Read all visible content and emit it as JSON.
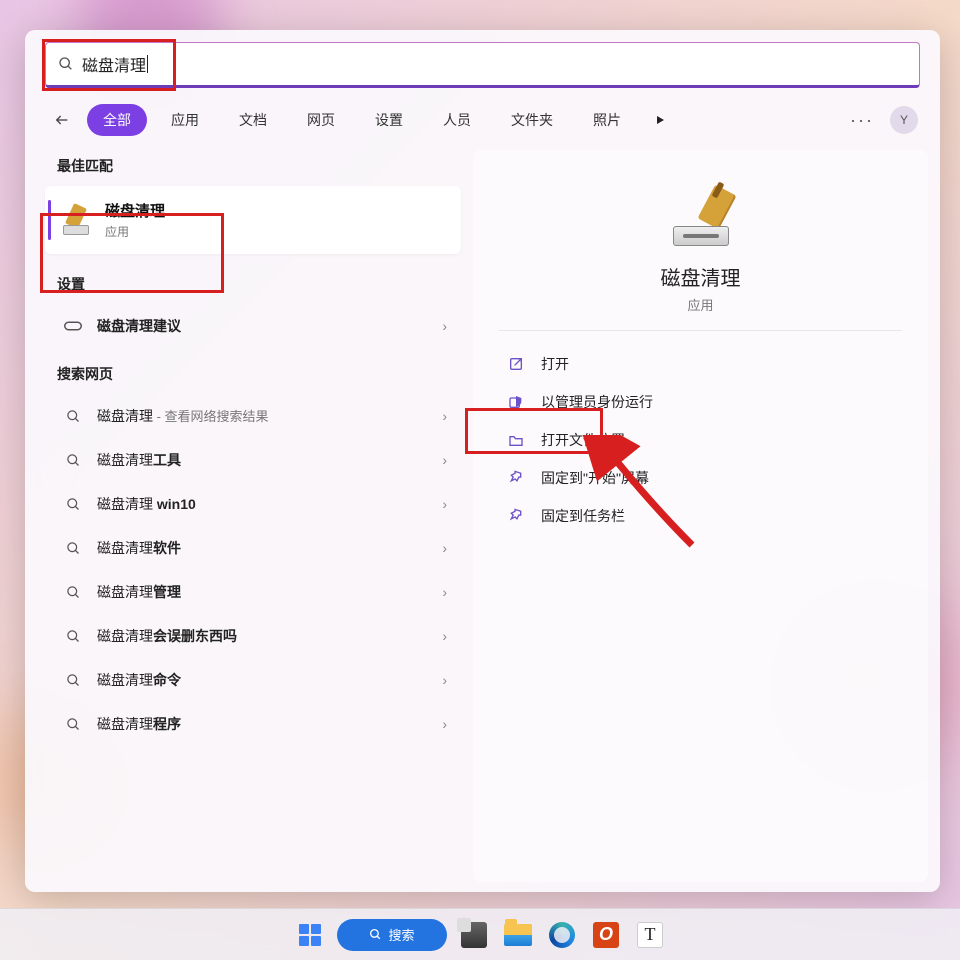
{
  "search": {
    "query": "磁盘清理"
  },
  "tabs": {
    "items": [
      "全部",
      "应用",
      "文档",
      "网页",
      "设置",
      "人员",
      "文件夹",
      "照片"
    ],
    "activeIndex": 0
  },
  "user": {
    "initial": "Y"
  },
  "sections": {
    "bestMatch": {
      "title": "最佳匹配"
    },
    "settings": {
      "title": "设置"
    },
    "web": {
      "title": "搜索网页"
    }
  },
  "bestMatch": {
    "title": "磁盘清理",
    "subtitle": "应用"
  },
  "settingsItems": [
    {
      "prefix": "",
      "bold": "磁盘清理建议",
      "suffix": ""
    }
  ],
  "webResults": [
    {
      "prefix": "磁盘清理",
      "bold": "",
      "suffix": " - 查看网络搜索结果"
    },
    {
      "prefix": "磁盘清理",
      "bold": "工具",
      "suffix": ""
    },
    {
      "prefix": "磁盘清理 ",
      "bold": "win10",
      "suffix": ""
    },
    {
      "prefix": "磁盘清理",
      "bold": "软件",
      "suffix": ""
    },
    {
      "prefix": "磁盘清理",
      "bold": "管理",
      "suffix": ""
    },
    {
      "prefix": "磁盘清理",
      "bold": "会误删东西吗",
      "suffix": ""
    },
    {
      "prefix": "磁盘清理",
      "bold": "命令",
      "suffix": ""
    },
    {
      "prefix": "磁盘清理",
      "bold": "程序",
      "suffix": ""
    }
  ],
  "detail": {
    "title": "磁盘清理",
    "subtitle": "应用",
    "actions": [
      {
        "icon": "open",
        "label": "打开"
      },
      {
        "icon": "admin",
        "label": "以管理员身份运行"
      },
      {
        "icon": "folder",
        "label": "打开文件位置"
      },
      {
        "icon": "pin",
        "label": "固定到\"开始\"屏幕"
      },
      {
        "icon": "pin",
        "label": "固定到任务栏"
      }
    ]
  },
  "taskbar": {
    "searchLabel": "搜索",
    "o": "O",
    "t": "T"
  }
}
